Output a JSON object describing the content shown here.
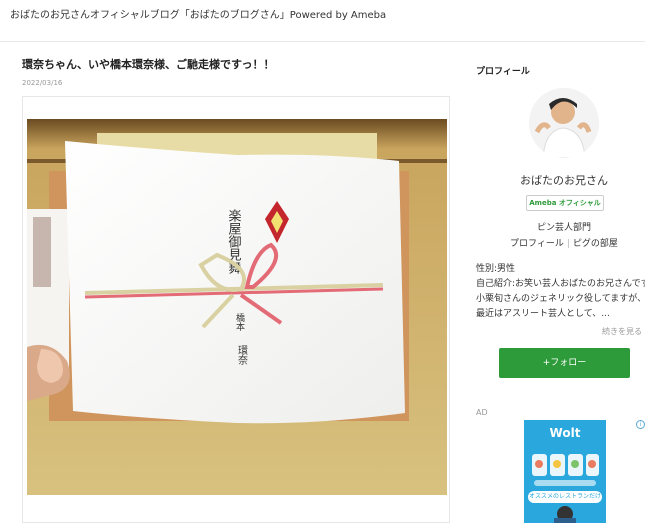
{
  "header": {
    "site_title": "おばたのお兄さんオフィシャルブログ「おばたのブログさん」Powered by Ameba"
  },
  "article": {
    "title": "環奈ちゃん、いや橋本環奈様、ご馳走様ですっ！！",
    "date": "2022/03/16",
    "photo": {
      "noshi_heading": "楽屋御見舞",
      "noshi_name_1": "橋本",
      "noshi_name_2": "環奈"
    }
  },
  "sidebar": {
    "heading": "プロフィール",
    "name": "おばたのお兄さん",
    "badge": "Ameba オフィシャル",
    "genre": "ピン芸人部門",
    "links": [
      "プロフィール",
      "ピグの部屋"
    ],
    "bio_lines": [
      "性別:男性",
      "自己紹介:お笑い芸人おばたのお兄さんです。",
      "小栗旬さんのジェネリック役してますが、",
      "最近はアスリート芸人として、..."
    ],
    "read_more": "続きを見る",
    "follow_label": "+フォロー",
    "ad_label": "AD",
    "ad": {
      "brand": "Wolt",
      "tagline": "オススメのレストランだけ"
    }
  },
  "colors": {
    "accent_green": "#2d9b3a",
    "ad_blue": "#2aa7dd"
  }
}
